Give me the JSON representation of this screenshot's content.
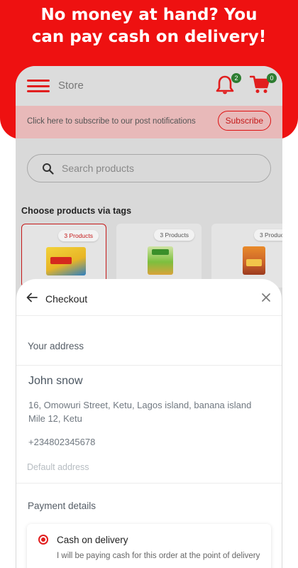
{
  "promo": {
    "headline_line1": "No money at hand? You",
    "headline_line2": "can pay cash on delivery!"
  },
  "app": {
    "title": "Store",
    "notifications_count": "2",
    "cart_count": "0",
    "notification_text": "Click here to subscribe to our post notifications",
    "subscribe_label": "Subscribe",
    "search_placeholder": "Search products",
    "tags_title": "Choose products via tags",
    "tag_cards": [
      {
        "label": "3 Products",
        "icon": "noodles-pack-icon",
        "selected": true
      },
      {
        "label": "3 Products",
        "icon": "snack-pack-icon",
        "selected": false
      },
      {
        "label": "3 Produc",
        "icon": "noodles-pack-icon",
        "selected": false
      }
    ]
  },
  "checkout": {
    "title": "Checkout",
    "address_label": "Your address",
    "address": {
      "name": "John snow",
      "line": "16, Omowuri Street, Ketu, Lagos island, banana island Mile 12, Ketu",
      "phone": "+234802345678",
      "default_label": "Default address"
    },
    "payment_label": "Payment details",
    "payment_option": {
      "title": "Cash on delivery",
      "description": "I will be paying cash for this order at the point of delivery"
    }
  },
  "colors": {
    "brand_red": "#ee1111",
    "badge_green": "#2e7d32"
  }
}
